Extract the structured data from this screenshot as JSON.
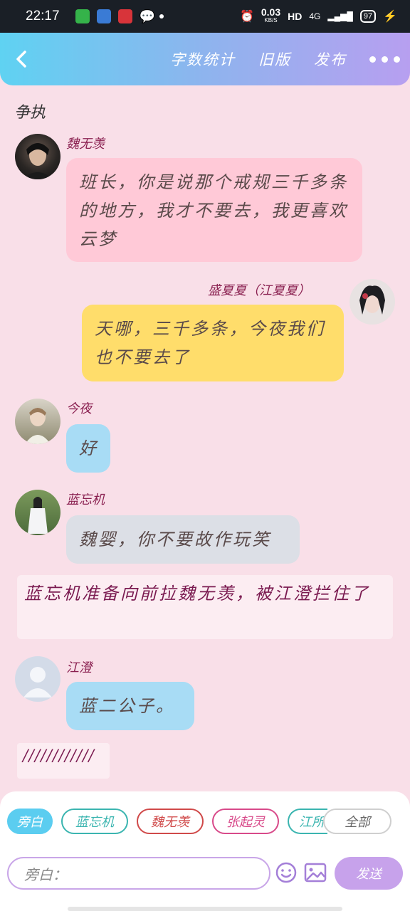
{
  "status_bar": {
    "time": "22:17",
    "net_speed": "0.03",
    "net_unit": "KB/S",
    "hd": "HD",
    "network": "4G",
    "battery": "97"
  },
  "top_bar": {
    "actions": [
      "字数统计",
      "旧版",
      "发布"
    ]
  },
  "chat": {
    "title": "争执",
    "messages": [
      {
        "name": "魏无羡",
        "text": "班长，你是说那个戒规三千多条的地方，我才不要去，我更喜欢云梦"
      },
      {
        "name": "盛夏夏（江夏夏）",
        "text": "天哪，三千多条，今夜我们也不要去了"
      },
      {
        "name": "今夜",
        "text": "好"
      },
      {
        "name": "蓝忘机",
        "text": "魏婴，你不要故作玩笑"
      },
      {
        "name": "江澄",
        "text": "蓝二公子。"
      }
    ],
    "narration": "蓝忘机准备向前拉魏无羡，被江澄拦住了",
    "slashes": "////////////"
  },
  "bottom": {
    "chips": [
      "旁白",
      "蓝忘机",
      "魏无羡",
      "张起灵",
      "江所",
      "全部"
    ],
    "input_placeholder": "旁白：",
    "send_label": "发送"
  },
  "colors": {
    "background": "#f9dfe8",
    "pink_bubble": "#ffc9d7",
    "yellow_bubble": "#ffdd6b",
    "blue_bubble": "#a8dcf5",
    "gray_bubble": "#dcdfe6",
    "accent_purple": "#c7a2eb"
  }
}
